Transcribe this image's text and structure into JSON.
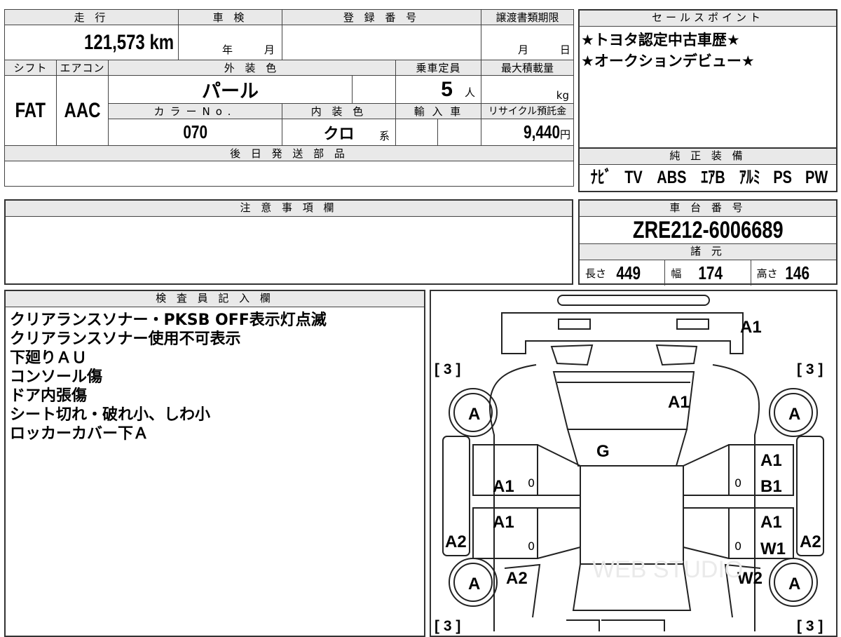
{
  "vehicle": {
    "mileage_header": "走 行",
    "mileage": "121,573 km",
    "inspection_header": "車 検",
    "inspection_year_unit": "年",
    "inspection_month_unit": "月",
    "registration_header": "登 録 番 号",
    "transfer_header": "譲渡書類期限",
    "transfer_month_unit": "月",
    "transfer_day_unit": "日",
    "shift_header": "シフト",
    "shift": "FAT",
    "ac_header": "エアコン",
    "ac": "AAC",
    "exterior_header": "外 装 色",
    "exterior": "パール",
    "capacity_header": "乗車定員",
    "capacity": "5",
    "capacity_unit": "人",
    "maxload_header": "最大積載量",
    "maxload_unit": "kg",
    "color_no_header": "カラーNo.",
    "color_no": "070",
    "interior_header": "内 装 色",
    "interior": "クロ",
    "interior_suffix": "系",
    "import_header": "輸 入 車",
    "recycle_header": "リサイクル預託金",
    "recycle": "9,440",
    "recycle_unit": "円",
    "later_parts_header": "後 日 発 送 部 品"
  },
  "sales": {
    "header": "セールスポイント",
    "points": [
      "★トヨタ認定中古車歴★",
      "★オークションデビュー★"
    ]
  },
  "equipment": {
    "header": "純 正 装 備",
    "items": [
      "ﾅﾋﾞ",
      "TV",
      "ABS",
      "ｴｱB",
      "ｱﾙﾐ",
      "PS",
      "PW"
    ]
  },
  "caution": {
    "header": "注 意 事 項 欄"
  },
  "chassis": {
    "header": "車 台 番 号",
    "number": "ZRE212-6006689"
  },
  "specs": {
    "header": "諸 元",
    "length_label": "長さ",
    "length": "449",
    "width_label": "幅",
    "width": "174",
    "height_label": "高さ",
    "height": "146"
  },
  "inspector": {
    "header": "検 査 員 記 入 欄",
    "lines": [
      "クリアランスソナー・PKSB OFF表示灯点滅",
      "クリアランスソナー使用不可表示",
      "下廻りＡＵ",
      "コンソール傷",
      "ドア内張傷",
      "シート切れ・破れ小、しわ小",
      "ロッカーカバー下Ａ"
    ]
  },
  "diagram": {
    "tire_bracket": "[ 3 ]",
    "tire_grade": "A",
    "marks": {
      "front_bumper": "A1",
      "bonnet": "A1",
      "windshield": "G",
      "front_door_left": "A1",
      "front_door_right_1": "A1",
      "front_door_right_2": "B1",
      "rear_door_left": "A1",
      "rear_door_right_1": "A1",
      "rear_door_right_2": "W1",
      "rocker_left": "A2",
      "rocker_right": "A2",
      "rear_fender_left": "A2",
      "rear_fender_right": "W2"
    },
    "zero": "0",
    "watermark": "WEB STUDIO"
  }
}
